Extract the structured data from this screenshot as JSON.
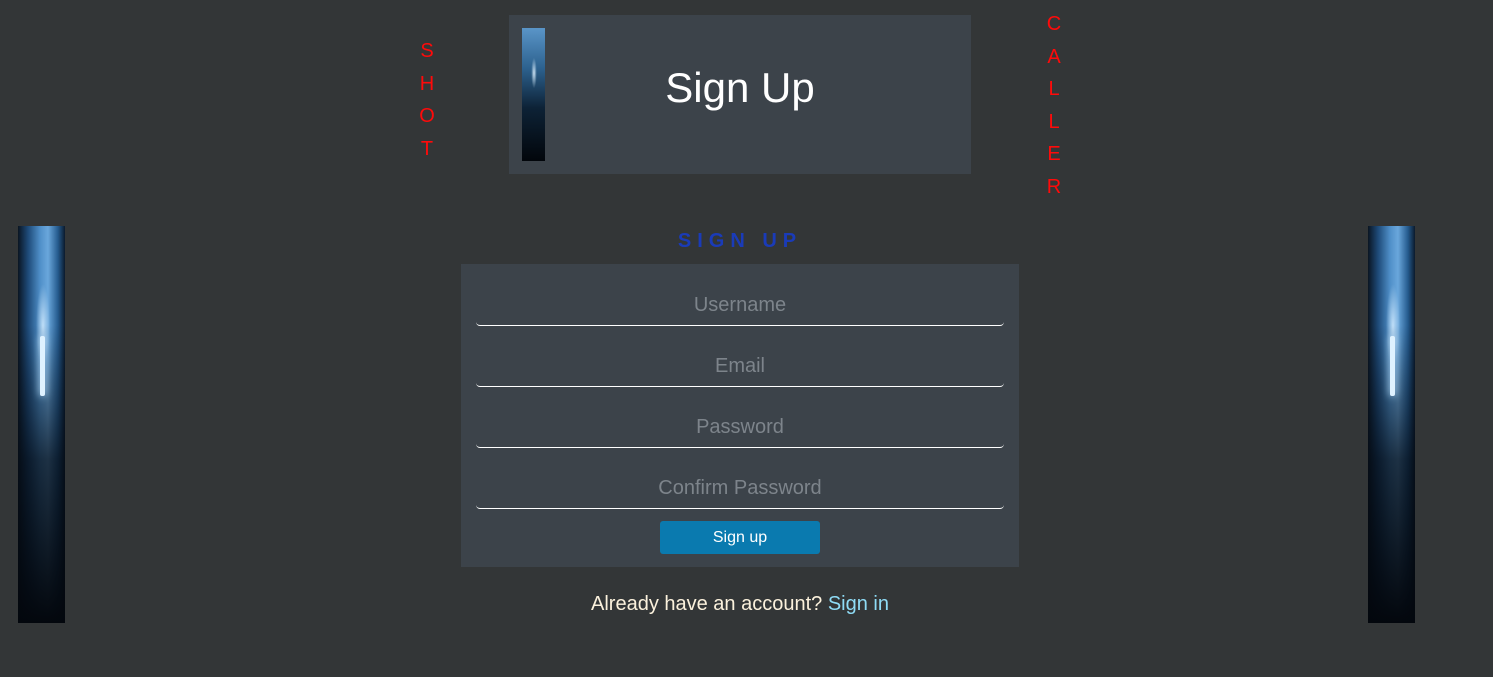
{
  "side_images": {
    "left_label": "decorative-image",
    "right_label": "decorative-image"
  },
  "brand": {
    "word_left": [
      "S",
      "H",
      "O",
      "T"
    ],
    "word_right": [
      "C",
      "A",
      "L",
      "L",
      "E",
      "R"
    ],
    "letter_color": "#ff0a0a"
  },
  "header": {
    "title": "Sign Up"
  },
  "form": {
    "heading": "SIGN UP",
    "heading_color": "#1a3bb8",
    "username_placeholder": "Username",
    "email_placeholder": "Email",
    "password_placeholder": "Password",
    "confirm_placeholder": "Confirm Password",
    "submit_label": "Sign up",
    "submit_color": "#0a7aaf"
  },
  "footer": {
    "prompt": "Already have an account?",
    "link_label": "Sign in",
    "link_color": "#8fdcf6"
  }
}
